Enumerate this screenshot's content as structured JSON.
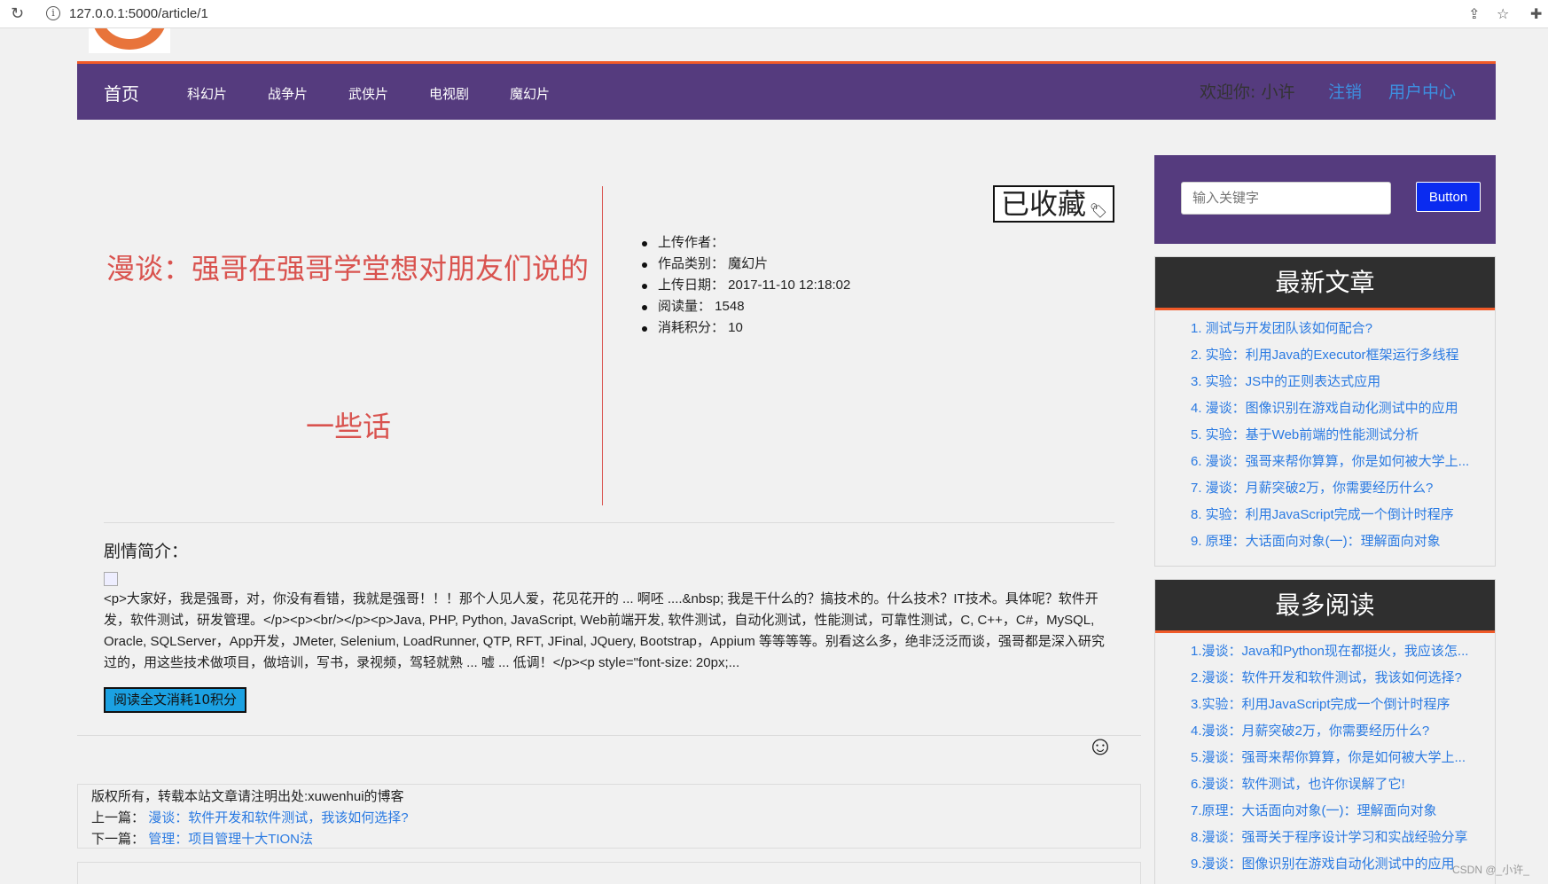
{
  "browser": {
    "url": "127.0.0.1:5000/article/1"
  },
  "nav": {
    "home": "首页",
    "categories": [
      "科幻片",
      "战争片",
      "武侠片",
      "电视剧",
      "魔幻片"
    ],
    "welcome_prefix": "欢迎你: ",
    "username": "小许",
    "logout": "注销",
    "user_center": "用户中心"
  },
  "article": {
    "title_line1": "漫谈：强哥在强哥学堂想对朋友们说的",
    "title_line2": "一些话",
    "collect_label": "已收藏",
    "meta": [
      "上传作者：",
      "作品类别： 魔幻片",
      "上传日期： 2017-11-10 12:18:02",
      "阅读量： 1548",
      "消耗积分： 10"
    ],
    "synopsis_label": "剧情简介：",
    "synopsis_text": "<p>大家好，我是强哥，对，你没有看错，我就是强哥！！！那个人见人爱，花见花开的 ... 啊呸 ....&nbsp; 我是干什么的？搞技术的。什么技术？IT技术。具体呢？软件开发，软件测试，研发管理。</p><p><br/></p><p>Java, PHP, Python, JavaScript, Web前端开发, 软件测试，自动化测试，性能测试，可靠性测试，C, C++，C#，MySQL, Oracle, SQLServer，App开发，JMeter, Selenium, LoadRunner, QTP, RFT, JFinal, JQuery, Bootstrap，Appium 等等等等。别看这么多，绝非泛泛而谈，强哥都是深入研究过的，用这些技术做项目，做培训，写书，录视频，驾轻就熟 ... 嘘 ... 低调！</p><p style=\"font-size: 20px;...",
    "read_button": "阅读全文消耗10积分",
    "copyright": "版权所有，转载本站文章请注明出处:xuwenhui的博客",
    "prev_label": "上一篇：",
    "prev_title": "漫谈：软件开发和软件测试，我该如何选择?",
    "next_label": "下一篇：",
    "next_title": "管理：项目管理十大TION法"
  },
  "search": {
    "placeholder": "输入关键字",
    "button": "Button"
  },
  "latest": {
    "title": "最新文章",
    "items": [
      "1. 测试与开发团队该如何配合?",
      "2. 实验：利用Java的Executor框架运行多线程",
      "3. 实验：JS中的正则表达式应用",
      "4. 漫谈：图像识别在游戏自动化测试中的应用",
      "5. 实验：基于Web前端的性能测试分析",
      "6. 漫谈：强哥来帮你算算，你是如何被大学上...",
      "7. 漫谈：月薪突破2万，你需要经历什么?",
      "8. 实验：利用JavaScript完成一个倒计时程序",
      "9. 原理：大话面向对象(一)：理解面向对象"
    ]
  },
  "popular": {
    "title": "最多阅读",
    "items": [
      "1.漫谈：Java和Python现在都挺火，我应该怎...",
      "2.漫谈：软件开发和软件测试，我该如何选择?",
      "3.实验：利用JavaScript完成一个倒计时程序",
      "4.漫谈：月薪突破2万，你需要经历什么?",
      "5.漫谈：强哥来帮你算算，你是如何被大学上...",
      "6.漫谈：软件测试，也许你误解了它!",
      "7.原理：大话面向对象(一)：理解面向对象",
      "8.漫谈：强哥关于程序设计学习和实战经验分享",
      "9.漫谈：图像识别在游戏自动化测试中的应用"
    ]
  },
  "watermark": "CSDN @_小许_"
}
